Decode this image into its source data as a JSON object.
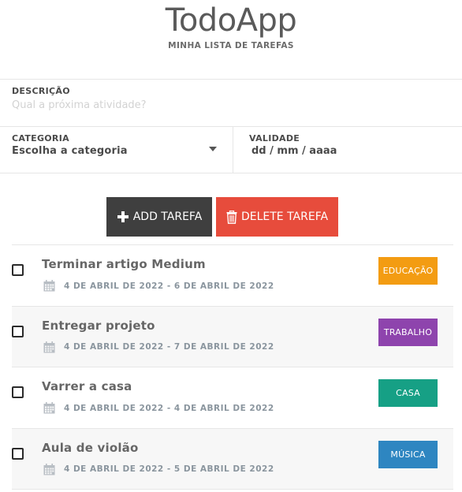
{
  "header": {
    "title": "TodoApp",
    "subtitle": "MINHA LISTA DE TAREFAS"
  },
  "form": {
    "description": {
      "label": "DESCRIÇÃO",
      "placeholder": "Qual a próxima atividade?",
      "value": ""
    },
    "category": {
      "label": "CATEGORIA",
      "selected": "Escolha a categoria"
    },
    "validity": {
      "label": "VALIDADE",
      "value": "dd / mm / aaaa"
    }
  },
  "actions": {
    "add_label": "ADD TAREFA",
    "add_icon": "plus-icon",
    "delete_label": "DELETE TAREFA",
    "delete_icon": "trash-icon"
  },
  "colors": {
    "add_button": "#3f3f3f",
    "delete_button": "#e74c3c",
    "educacao": "#f39c12",
    "trabalho": "#8e44ad",
    "casa": "#16a085",
    "musica": "#2e86c1"
  },
  "tasks": [
    {
      "title": "Terminar artigo Medium",
      "dates": "4 DE ABRIL DE 2022 - 6 DE ABRIL DE 2022",
      "category": "EDUCAÇÃO",
      "color": "#f39c12",
      "checked": false
    },
    {
      "title": "Entregar projeto",
      "dates": "4 DE ABRIL DE 2022 - 7 DE ABRIL DE 2022",
      "category": "TRABALHO",
      "color": "#8e44ad",
      "checked": false
    },
    {
      "title": "Varrer a casa",
      "dates": "4 DE ABRIL DE 2022 - 4 DE ABRIL DE 2022",
      "category": "CASA",
      "color": "#16a085",
      "checked": false
    },
    {
      "title": "Aula de violão",
      "dates": "4 DE ABRIL DE 2022 - 5 DE ABRIL DE 2022",
      "category": "MÚSICA",
      "color": "#2e86c1",
      "checked": false
    }
  ]
}
